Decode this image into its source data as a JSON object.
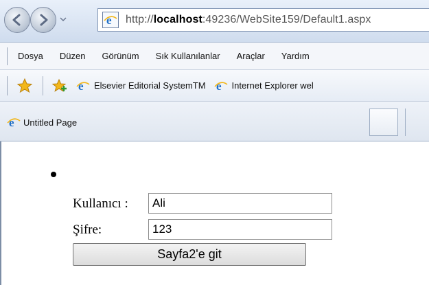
{
  "address_bar": {
    "url_prefix": "http://",
    "url_host": "localhost",
    "url_rest": ":49236/WebSite159/Default1.aspx"
  },
  "menu": {
    "items": [
      "Dosya",
      "Düzen",
      "Görünüm",
      "Sık Kullanılanlar",
      "Araçlar",
      "Yardım"
    ]
  },
  "favorites": {
    "links": [
      "Elsevier Editorial SystemTM",
      "Internet Explorer wel"
    ]
  },
  "tab": {
    "title": "Untitled Page"
  },
  "form": {
    "username_label": "Kullanıcı :",
    "username_value": "Ali",
    "password_label": "Şifre:",
    "password_value": "123",
    "submit_label": "Sayfa2'e git"
  },
  "colors": {
    "chrome_blue": "#cfdcee",
    "ie_blue": "#1f6fc7",
    "star_gold": "#f2b71b"
  },
  "icons": {
    "back": "back-arrow-icon",
    "forward": "forward-arrow-icon",
    "page": "page-icon",
    "favorites": "star-icon",
    "add_favorites": "add-favorites-icon",
    "ie": "ie-icon"
  }
}
